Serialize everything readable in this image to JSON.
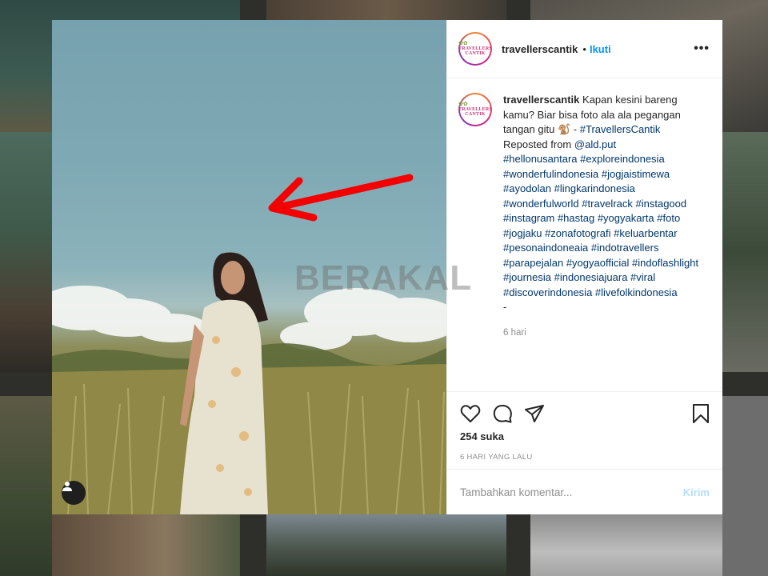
{
  "post": {
    "username": "travellerscantik",
    "follow_label": "Ikuti",
    "separator": "•",
    "more_label": "•••",
    "avatar_logo_line1": "TRAVELLERS",
    "avatar_logo_line2": "CANTIK",
    "caption_username": "travellerscantik",
    "caption_text": "Kapan kesini bareng kamu? Biar bisa foto ala ala pegangan tangan gitu",
    "caption_emoji": "🐒",
    "caption_dash": "-",
    "caption_brand_tag": "#TravellersCantik",
    "repost_prefix": "Reposted from",
    "repost_user": "@ald.put",
    "hashtags": [
      "#hellonusantara",
      "#exploreindonesia",
      "#wonderfulindonesia",
      "#jogjaistimewa",
      "#ayodolan",
      "#lingkarindonesia",
      "#wonderfulworld",
      "#travelrack",
      "#instagood",
      "#instagram",
      "#hastag",
      "#yogyakarta",
      "#foto",
      "#jogjaku",
      "#zonafotografi",
      "#keluarbentar",
      "#pesonaindoneaia",
      "#indotravellers",
      "#parapejalan",
      "#yogyaofficial",
      "#indoflashlight",
      "#journesia",
      "#indonesiajuara",
      "#viral",
      "#discoverindonesia",
      "#livefolkindonesia"
    ],
    "caption_end": "-",
    "caption_time": "6 hari",
    "likes": "254 suka",
    "time_ago": "6 HARI YANG LALU",
    "comment_placeholder": "Tambahkan komentar...",
    "post_button": "Kirim"
  },
  "overlay": {
    "watermark": "BERAKAL"
  },
  "colors": {
    "accent": "#0095f6",
    "post_disabled": "#b2dffc",
    "arrow": "#f40000",
    "link": "#00376b"
  },
  "icons": {
    "like": "heart-icon",
    "comment": "comment-icon",
    "share": "share-icon",
    "save": "bookmark-icon",
    "user_tag": "user-icon"
  }
}
